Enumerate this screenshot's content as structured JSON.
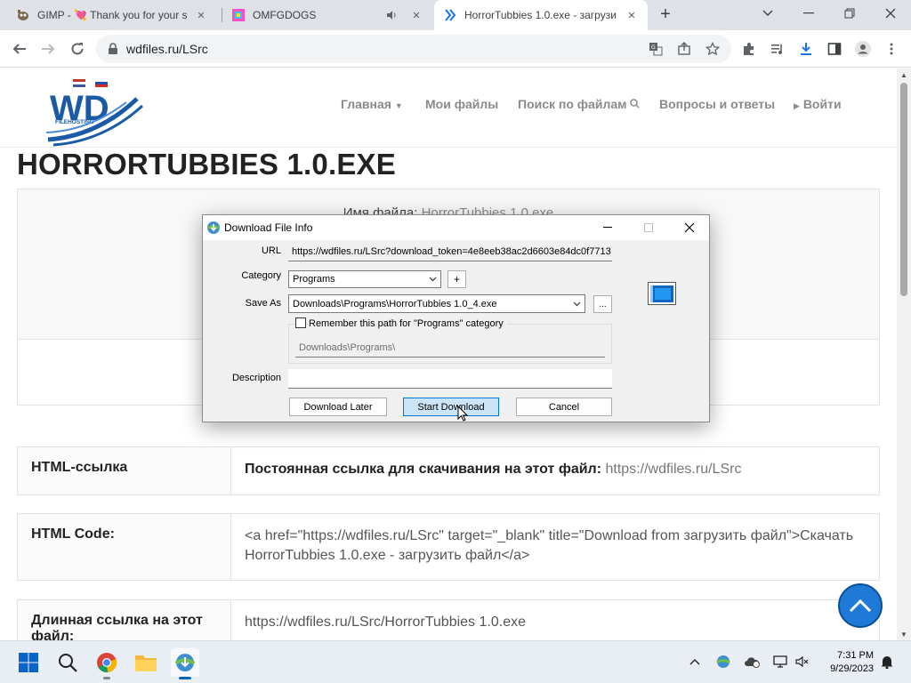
{
  "browser": {
    "tabs": [
      {
        "title": "GIMP - 💘 Thank you for your s",
        "favicon": "gimp-icon"
      },
      {
        "title": "OMFGDOGS",
        "favicon": "omfgdogs-icon",
        "audio": true
      },
      {
        "title": "HorrorTubbies 1.0.exe - загрузи",
        "favicon": "wdfiles-icon",
        "active": true
      }
    ],
    "address": "wdfiles.ru/LSrc"
  },
  "site": {
    "menu": {
      "home": "Главная",
      "myfiles": "Мои файлы",
      "search": "Поиск по файлам",
      "faq": "Вопросы и ответы",
      "login": "Войти"
    },
    "logo_text": "WD",
    "logo_sub": "FILEHOSTING",
    "page_title": "HORRORTUBBIES 1.0.EXE",
    "file_label": "Имя файла:",
    "file_name": "HorrorTubbies 1.0.exe",
    "rows": [
      {
        "label": "HTML-ссылка",
        "value_bold": "Постоянная ссылка для скачивания на этот файл:",
        "value": " https://wdfiles.ru/LSrc"
      },
      {
        "label": "HTML Code:",
        "value": "<a href=\"https://wdfiles.ru/LSrc\" target=\"_blank\" title=\"Download from загрузить файл\">Скачать HorrorTubbies 1.0.exe - загрузить файл</a>"
      },
      {
        "label": "Длинная ссылка на этот файл:",
        "value": "https://wdfiles.ru/LSrc/HorrorTubbies 1.0.exe"
      }
    ]
  },
  "dialog": {
    "title": "Download File Info",
    "url_label": "URL",
    "url_value": "https://wdfiles.ru/LSrc?download_token=4e8eeb38ac2d6603e84dc0f7713",
    "category_label": "Category",
    "category_value": "Programs",
    "add_label": "+",
    "saveas_label": "Save As",
    "saveas_value": "Downloads\\Programs\\HorrorTubbies 1.0_4.exe",
    "browse_label": "...",
    "remember_label": "Remember this path for \"Programs\" category",
    "remember_checked": false,
    "path_value": "Downloads\\Programs\\",
    "description_label": "Description",
    "description_value": "",
    "download_later": "Download Later",
    "start_download": "Start Download",
    "cancel": "Cancel"
  },
  "taskbar": {
    "time": "7:31 PM",
    "date": "9/29/2023"
  },
  "colors": {
    "accent_blue": "#1e7ad6",
    "logo_blue": "#1a5aa6",
    "dialog_default_border": "#0078d7"
  }
}
